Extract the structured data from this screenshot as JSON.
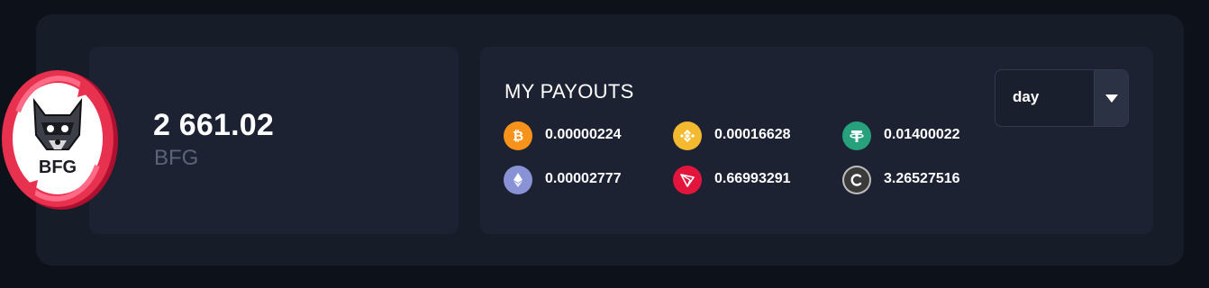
{
  "balance": {
    "amount": "2 661.02",
    "unit": "BFG",
    "logo_text": "BFG"
  },
  "payouts": {
    "title": "MY PAYOUTS",
    "period_select": {
      "value": "day"
    },
    "coins": [
      {
        "icon": "bitcoin-icon",
        "color": "#f7931a",
        "value": "0.00000224"
      },
      {
        "icon": "binance-coin-icon",
        "color": "#f3ba2f",
        "value": "0.00016628"
      },
      {
        "icon": "tether-icon",
        "color": "#26a17b",
        "value": "0.01400022"
      },
      {
        "icon": "ethereum-icon",
        "color": "#8a92d6",
        "value": "0.00002777"
      },
      {
        "icon": "tron-icon",
        "color": "#e4153d",
        "value": "0.66993291"
      },
      {
        "icon": "bfg-coin-icon",
        "color": "#3a3a3a",
        "value": "3.26527516"
      }
    ]
  },
  "colors": {
    "background": "#0d1119",
    "panel": "#171d28",
    "card": "#1d2233",
    "muted_text": "#5a6479"
  }
}
